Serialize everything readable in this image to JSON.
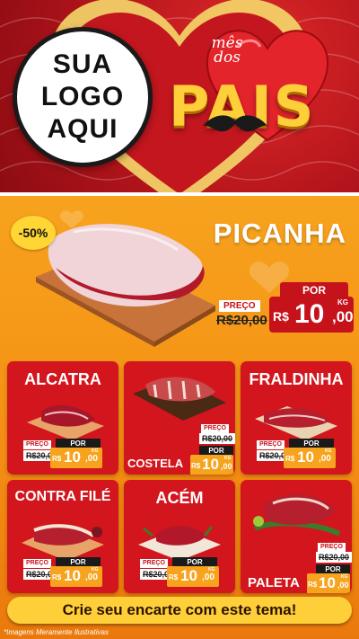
{
  "brand": {
    "logo_placeholder_lines": [
      "SUA",
      "LOGO",
      "AQUI"
    ],
    "campaign_line1": "mês",
    "campaign_line2": "dos",
    "campaign_title": "PAIS"
  },
  "colors": {
    "accent_red": "#d3151d",
    "accent_orange": "#f7a31e",
    "accent_yellow": "#ffcf3a"
  },
  "featured": {
    "name": "PICANHA",
    "discount": "-50%",
    "old_label": "PREÇO",
    "old_price": "R$20,00",
    "new_label": "POR",
    "currency": "R$",
    "price_int": "10",
    "price_dec": ",00",
    "unit": "KG"
  },
  "products": [
    {
      "name": "ALCATRA",
      "old_label": "PREÇO",
      "old_price": "R$20,00",
      "new_label": "POR",
      "currency": "R$",
      "price_int": "10",
      "price_dec": ",00",
      "unit": "KG"
    },
    {
      "name": "COSTELA",
      "old_label": "PREÇO",
      "old_price": "R$20,00",
      "new_label": "POR",
      "currency": "R$",
      "price_int": "10",
      "price_dec": ",00",
      "unit": "KG"
    },
    {
      "name": "FRALDINHA",
      "old_label": "PREÇO",
      "old_price": "R$20,00",
      "new_label": "POR",
      "currency": "R$",
      "price_int": "10",
      "price_dec": ",00",
      "unit": "KG"
    },
    {
      "name": "CONTRA FILÉ",
      "old_label": "PREÇO",
      "old_price": "R$20,00",
      "new_label": "POR",
      "currency": "R$",
      "price_int": "10",
      "price_dec": ",00",
      "unit": "KG"
    },
    {
      "name": "ACÉM",
      "old_label": "PREÇO",
      "old_price": "R$20,00",
      "new_label": "POR",
      "currency": "R$",
      "price_int": "10",
      "price_dec": ",00",
      "unit": "KG"
    },
    {
      "name": "PALETA",
      "old_label": "PREÇO",
      "old_price": "R$20,00",
      "new_label": "POR",
      "currency": "R$",
      "price_int": "10",
      "price_dec": ",00",
      "unit": "KG"
    }
  ],
  "cta": "Crie seu encarte com este tema!",
  "disclaimer": "*Imagens Meramente Ilustrativas"
}
